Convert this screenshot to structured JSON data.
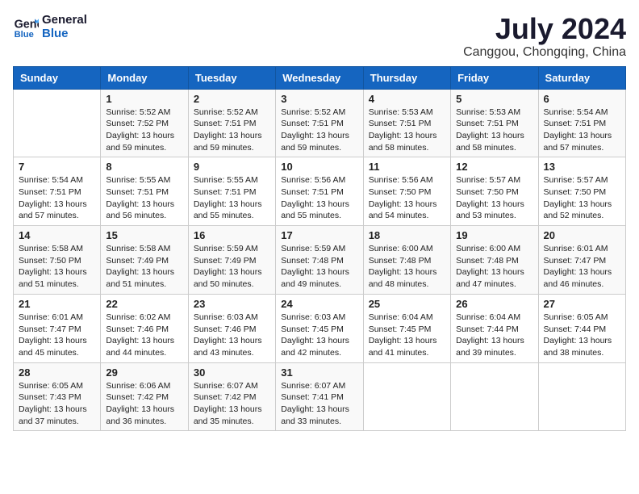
{
  "logo": {
    "line1": "General",
    "line2": "Blue"
  },
  "title": {
    "month_year": "July 2024",
    "location": "Canggou, Chongqing, China"
  },
  "weekdays": [
    "Sunday",
    "Monday",
    "Tuesday",
    "Wednesday",
    "Thursday",
    "Friday",
    "Saturday"
  ],
  "weeks": [
    [
      {
        "day": null,
        "sunrise": null,
        "sunset": null,
        "daylight": null
      },
      {
        "day": "1",
        "sunrise": "Sunrise: 5:52 AM",
        "sunset": "Sunset: 7:52 PM",
        "daylight": "Daylight: 13 hours and 59 minutes."
      },
      {
        "day": "2",
        "sunrise": "Sunrise: 5:52 AM",
        "sunset": "Sunset: 7:51 PM",
        "daylight": "Daylight: 13 hours and 59 minutes."
      },
      {
        "day": "3",
        "sunrise": "Sunrise: 5:52 AM",
        "sunset": "Sunset: 7:51 PM",
        "daylight": "Daylight: 13 hours and 59 minutes."
      },
      {
        "day": "4",
        "sunrise": "Sunrise: 5:53 AM",
        "sunset": "Sunset: 7:51 PM",
        "daylight": "Daylight: 13 hours and 58 minutes."
      },
      {
        "day": "5",
        "sunrise": "Sunrise: 5:53 AM",
        "sunset": "Sunset: 7:51 PM",
        "daylight": "Daylight: 13 hours and 58 minutes."
      },
      {
        "day": "6",
        "sunrise": "Sunrise: 5:54 AM",
        "sunset": "Sunset: 7:51 PM",
        "daylight": "Daylight: 13 hours and 57 minutes."
      }
    ],
    [
      {
        "day": "7",
        "sunrise": "Sunrise: 5:54 AM",
        "sunset": "Sunset: 7:51 PM",
        "daylight": "Daylight: 13 hours and 57 minutes."
      },
      {
        "day": "8",
        "sunrise": "Sunrise: 5:55 AM",
        "sunset": "Sunset: 7:51 PM",
        "daylight": "Daylight: 13 hours and 56 minutes."
      },
      {
        "day": "9",
        "sunrise": "Sunrise: 5:55 AM",
        "sunset": "Sunset: 7:51 PM",
        "daylight": "Daylight: 13 hours and 55 minutes."
      },
      {
        "day": "10",
        "sunrise": "Sunrise: 5:56 AM",
        "sunset": "Sunset: 7:51 PM",
        "daylight": "Daylight: 13 hours and 55 minutes."
      },
      {
        "day": "11",
        "sunrise": "Sunrise: 5:56 AM",
        "sunset": "Sunset: 7:50 PM",
        "daylight": "Daylight: 13 hours and 54 minutes."
      },
      {
        "day": "12",
        "sunrise": "Sunrise: 5:57 AM",
        "sunset": "Sunset: 7:50 PM",
        "daylight": "Daylight: 13 hours and 53 minutes."
      },
      {
        "day": "13",
        "sunrise": "Sunrise: 5:57 AM",
        "sunset": "Sunset: 7:50 PM",
        "daylight": "Daylight: 13 hours and 52 minutes."
      }
    ],
    [
      {
        "day": "14",
        "sunrise": "Sunrise: 5:58 AM",
        "sunset": "Sunset: 7:50 PM",
        "daylight": "Daylight: 13 hours and 51 minutes."
      },
      {
        "day": "15",
        "sunrise": "Sunrise: 5:58 AM",
        "sunset": "Sunset: 7:49 PM",
        "daylight": "Daylight: 13 hours and 51 minutes."
      },
      {
        "day": "16",
        "sunrise": "Sunrise: 5:59 AM",
        "sunset": "Sunset: 7:49 PM",
        "daylight": "Daylight: 13 hours and 50 minutes."
      },
      {
        "day": "17",
        "sunrise": "Sunrise: 5:59 AM",
        "sunset": "Sunset: 7:48 PM",
        "daylight": "Daylight: 13 hours and 49 minutes."
      },
      {
        "day": "18",
        "sunrise": "Sunrise: 6:00 AM",
        "sunset": "Sunset: 7:48 PM",
        "daylight": "Daylight: 13 hours and 48 minutes."
      },
      {
        "day": "19",
        "sunrise": "Sunrise: 6:00 AM",
        "sunset": "Sunset: 7:48 PM",
        "daylight": "Daylight: 13 hours and 47 minutes."
      },
      {
        "day": "20",
        "sunrise": "Sunrise: 6:01 AM",
        "sunset": "Sunset: 7:47 PM",
        "daylight": "Daylight: 13 hours and 46 minutes."
      }
    ],
    [
      {
        "day": "21",
        "sunrise": "Sunrise: 6:01 AM",
        "sunset": "Sunset: 7:47 PM",
        "daylight": "Daylight: 13 hours and 45 minutes."
      },
      {
        "day": "22",
        "sunrise": "Sunrise: 6:02 AM",
        "sunset": "Sunset: 7:46 PM",
        "daylight": "Daylight: 13 hours and 44 minutes."
      },
      {
        "day": "23",
        "sunrise": "Sunrise: 6:03 AM",
        "sunset": "Sunset: 7:46 PM",
        "daylight": "Daylight: 13 hours and 43 minutes."
      },
      {
        "day": "24",
        "sunrise": "Sunrise: 6:03 AM",
        "sunset": "Sunset: 7:45 PM",
        "daylight": "Daylight: 13 hours and 42 minutes."
      },
      {
        "day": "25",
        "sunrise": "Sunrise: 6:04 AM",
        "sunset": "Sunset: 7:45 PM",
        "daylight": "Daylight: 13 hours and 41 minutes."
      },
      {
        "day": "26",
        "sunrise": "Sunrise: 6:04 AM",
        "sunset": "Sunset: 7:44 PM",
        "daylight": "Daylight: 13 hours and 39 minutes."
      },
      {
        "day": "27",
        "sunrise": "Sunrise: 6:05 AM",
        "sunset": "Sunset: 7:44 PM",
        "daylight": "Daylight: 13 hours and 38 minutes."
      }
    ],
    [
      {
        "day": "28",
        "sunrise": "Sunrise: 6:05 AM",
        "sunset": "Sunset: 7:43 PM",
        "daylight": "Daylight: 13 hours and 37 minutes."
      },
      {
        "day": "29",
        "sunrise": "Sunrise: 6:06 AM",
        "sunset": "Sunset: 7:42 PM",
        "daylight": "Daylight: 13 hours and 36 minutes."
      },
      {
        "day": "30",
        "sunrise": "Sunrise: 6:07 AM",
        "sunset": "Sunset: 7:42 PM",
        "daylight": "Daylight: 13 hours and 35 minutes."
      },
      {
        "day": "31",
        "sunrise": "Sunrise: 6:07 AM",
        "sunset": "Sunset: 7:41 PM",
        "daylight": "Daylight: 13 hours and 33 minutes."
      },
      {
        "day": null,
        "sunrise": null,
        "sunset": null,
        "daylight": null
      },
      {
        "day": null,
        "sunrise": null,
        "sunset": null,
        "daylight": null
      },
      {
        "day": null,
        "sunrise": null,
        "sunset": null,
        "daylight": null
      }
    ]
  ]
}
